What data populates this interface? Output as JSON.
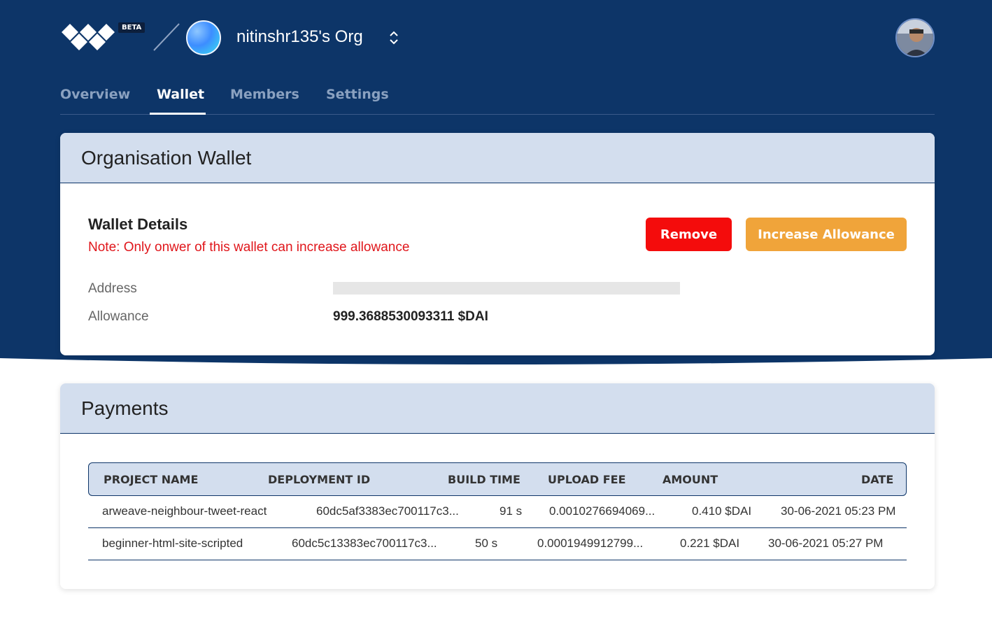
{
  "header": {
    "beta_badge": "BETA",
    "org_name": "nitinshr135's Org",
    "logo_icon": "arweave-logo-icon",
    "switch_icon": "chevron-updown-icon",
    "avatar_icon": "user-avatar-icon"
  },
  "tabs": [
    {
      "label": "Overview",
      "active": false
    },
    {
      "label": "Wallet",
      "active": true
    },
    {
      "label": "Members",
      "active": false
    },
    {
      "label": "Settings",
      "active": false
    }
  ],
  "wallet_card": {
    "title": "Organisation Wallet",
    "details_title": "Wallet Details",
    "note": "Note: Only onwer of this wallet can increase allowance",
    "remove_label": "Remove",
    "increase_label": "Increase Allowance",
    "address_label": "Address",
    "address_value": "",
    "allowance_label": "Allowance",
    "allowance_value": "999.3688530093311 $DAI"
  },
  "payments_card": {
    "title": "Payments",
    "columns": [
      "PROJECT NAME",
      "DEPLOYMENT ID",
      "BUILD TIME",
      "UPLOAD FEE",
      "AMOUNT",
      "DATE"
    ],
    "rows": [
      {
        "project": "arweave-neighbour-tweet-react",
        "deployment": "60dc5af3383ec700117c3...",
        "build_time": "91 s",
        "upload_fee": "0.0010276694069...",
        "amount": "0.410 $DAI",
        "date": "30-06-2021 05:23 PM"
      },
      {
        "project": "beginner-html-site-scripted",
        "deployment": "60dc5c13383ec700117c3...",
        "build_time": "50 s",
        "upload_fee": "0.0001949912799...",
        "amount": "0.221 $DAI",
        "date": "30-06-2021 05:27 PM"
      }
    ]
  },
  "colors": {
    "navy": "#0d3568",
    "remove": "#f40c0c",
    "increase": "#f0a43a",
    "note": "#e0161b",
    "card_header": "#d3deee"
  }
}
